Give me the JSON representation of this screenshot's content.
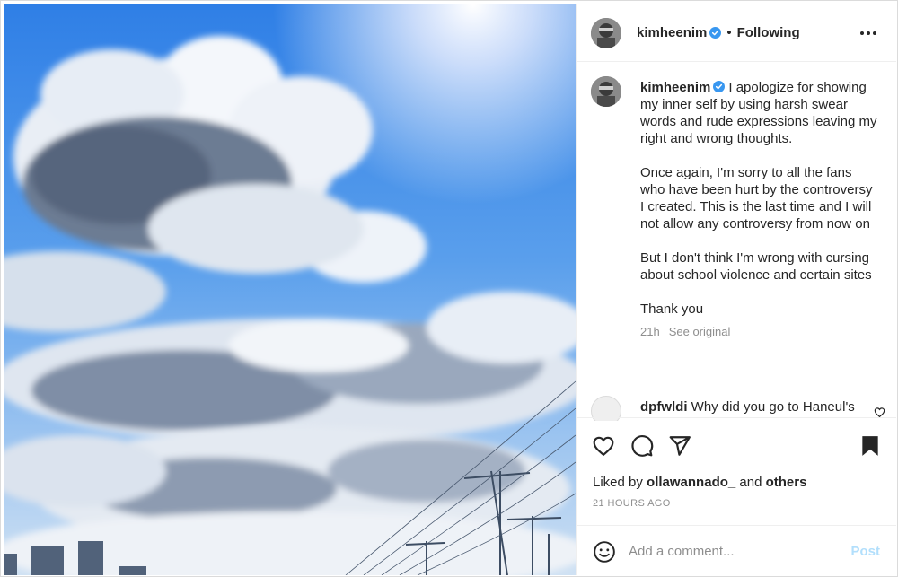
{
  "post": {
    "username": "kimheenim",
    "following_label": "Following",
    "separator": "•",
    "image_description_icon": "sky-photo"
  },
  "caption": {
    "username": "kimheenim",
    "paragraphs": [
      "I apologize for showing my inner self by using harsh swear words and rude expressions leaving my right and wrong thoughts.",
      "Once again, I'm sorry to all the fans who have been hurt by the controversy I created. This is the last time and I will not allow any controversy from now on",
      "But I don't think I'm wrong with cursing about school violence and certain sites",
      "Thank you"
    ],
    "age": "21h",
    "see_original": "See original"
  },
  "comment": {
    "username": "dpfwldi",
    "text": "Why did you go to Haneul's"
  },
  "actions": {
    "liked_prefix": "Liked by",
    "liked_user": "ollawannado_",
    "liked_and": "and",
    "liked_others": "others",
    "timestamp": "21 HOURS AGO"
  },
  "composer": {
    "placeholder": "Add a comment...",
    "post_label": "Post"
  },
  "colors": {
    "verified": "#3897f0",
    "text": "#262626",
    "muted": "#8e8e8e",
    "post_disabled": "#b2dffc",
    "sky_top": "#3a86e8",
    "sky_bottom": "#cfe4f6"
  },
  "icons": [
    "more-options-icon",
    "verified-badge-icon",
    "heart-icon",
    "comment-icon",
    "share-icon",
    "bookmark-icon",
    "emoji-icon",
    "comment-heart-icon"
  ]
}
